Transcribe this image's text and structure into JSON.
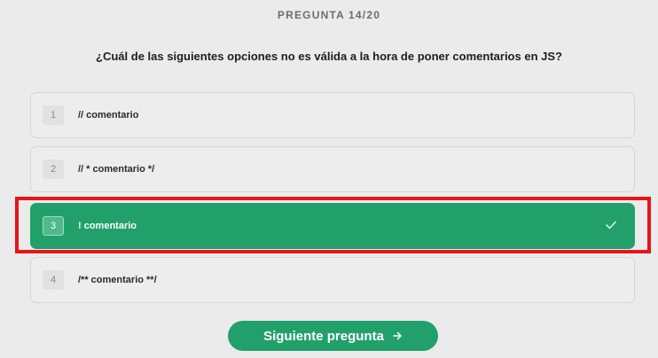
{
  "quiz": {
    "counter": "PREGUNTA 14/20",
    "question": "¿Cuál de las siguientes opciones no es válida a la hora de poner comentarios en JS?",
    "options": [
      {
        "number": "1",
        "label": "// comentario"
      },
      {
        "number": "2",
        "label": "// * comentario */"
      },
      {
        "number": "3",
        "label": "! comentario",
        "selected": true
      },
      {
        "number": "4",
        "label": "/** comentario **/"
      }
    ],
    "next_button": {
      "label": "Siguiente pregunta",
      "icon": "arrow-right-icon"
    }
  },
  "colors": {
    "accent": "#22a06b",
    "background": "#ebebeb",
    "highlight_box": "#e8141b"
  }
}
